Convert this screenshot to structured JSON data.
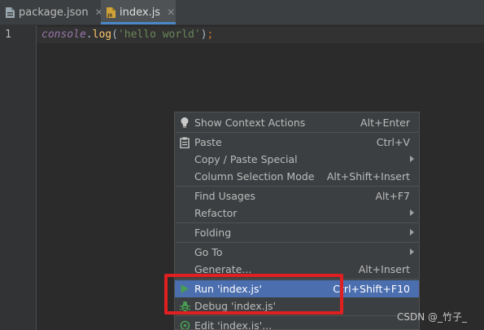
{
  "tabs": [
    {
      "label": "package.json",
      "icon": "json-file-icon",
      "active": false
    },
    {
      "label": "index.js",
      "icon": "js-file-icon",
      "active": true
    }
  ],
  "editor": {
    "line_number": "1",
    "code": {
      "object": "console",
      "dot": ".",
      "method": "log",
      "open": "(",
      "string": "'hello world'",
      "close": ")",
      "semicolon": ";"
    }
  },
  "menu": {
    "items": [
      {
        "label": "Show Context Actions",
        "shortcut": "Alt+Enter",
        "icon": "lightbulb-icon"
      },
      {
        "label": "Paste",
        "shortcut": "Ctrl+V",
        "icon": "clipboard-icon"
      },
      {
        "label": "Copy / Paste Special",
        "submenu": true
      },
      {
        "label": "Column Selection Mode",
        "shortcut": "Alt+Shift+Insert"
      },
      {
        "label": "Find Usages",
        "shortcut": "Alt+F7"
      },
      {
        "label": "Refactor",
        "submenu": true
      },
      {
        "label": "Folding",
        "submenu": true
      },
      {
        "label": "Go To",
        "submenu": true
      },
      {
        "label": "Generate...",
        "shortcut": "Alt+Insert"
      },
      {
        "label": "Run 'index.js'",
        "shortcut": "Ctrl+Shift+F10",
        "icon": "run-icon",
        "selected": true
      },
      {
        "label": "Debug 'index.js'",
        "icon": "debug-icon"
      },
      {
        "label": "Edit 'index.js'...",
        "icon": "edit-config-icon"
      }
    ]
  },
  "watermark": "CSDN @_竹子_",
  "colors": {
    "selection": "#4b6eaf",
    "annotation": "#e02020",
    "run_green": "#499c54"
  }
}
